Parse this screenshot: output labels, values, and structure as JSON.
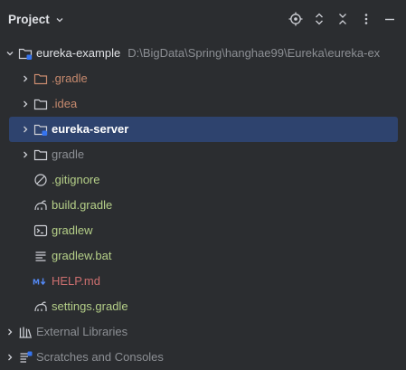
{
  "header": {
    "title": "Project",
    "icons": [
      "locate-icon",
      "expand-collapse-icon",
      "collapse-all-icon",
      "more-options-icon",
      "minimize-icon"
    ]
  },
  "tree": {
    "root": {
      "name": "eureka-example",
      "path": "D:\\BigData\\Spring\\hanghae99\\Eureka\\eureka-ex"
    },
    "items": [
      {
        "name": ".gradle",
        "type": "folder",
        "color": "#c78a6e"
      },
      {
        "name": ".idea",
        "type": "folder",
        "color": "#c78a6e"
      },
      {
        "name": "eureka-server",
        "type": "module",
        "color": "#ffffff"
      },
      {
        "name": "gradle",
        "type": "folder",
        "color": "#8c8f94"
      },
      {
        "name": ".gitignore",
        "type": "ignore-file",
        "color": "#b5cf88"
      },
      {
        "name": "build.gradle",
        "type": "gradle-file",
        "color": "#b5cf88"
      },
      {
        "name": "gradlew",
        "type": "shell-file",
        "color": "#b5cf88"
      },
      {
        "name": "gradlew.bat",
        "type": "text-file",
        "color": "#b5cf88"
      },
      {
        "name": "HELP.md",
        "type": "markdown-file",
        "color": "#cc6f6f"
      },
      {
        "name": "settings.gradle",
        "type": "gradle-file",
        "color": "#b5cf88"
      }
    ],
    "external_libraries": "External Libraries",
    "scratches": "Scratches and Consoles"
  },
  "colors": {
    "background": "#2b2d30",
    "selection": "#2e436e",
    "text": "#dfe1e5",
    "path_gray": "#8c8f94",
    "excluded_orange": "#c78a6e",
    "added_green": "#b5cf88",
    "modified_red": "#cc6f6f"
  }
}
